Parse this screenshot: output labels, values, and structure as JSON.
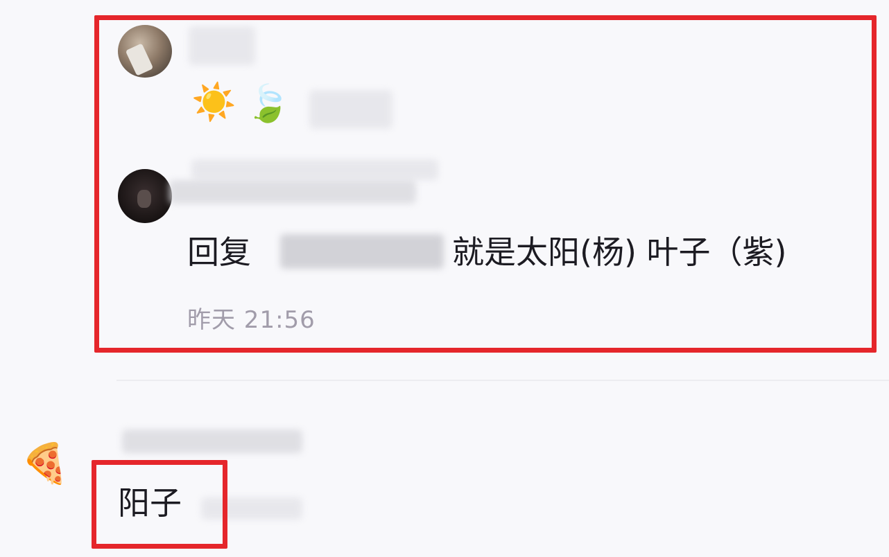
{
  "thread": {
    "first_comment": {
      "avatar": "user-avatar-photo",
      "emoji": [
        "sun-icon",
        "leaf-icon"
      ]
    },
    "reply_comment": {
      "avatar": "user-avatar-dark",
      "reply_prefix": "回复",
      "reply_text": "就是太阳(杨) 叶子（紫)",
      "timestamp": "昨天 21:56"
    },
    "second_comment": {
      "avatar_icon": "pizza-icon",
      "text": "阳子"
    }
  },
  "colors": {
    "highlight": "#e5262b",
    "timestamp": "#a19caa",
    "background": "#f8f8fb"
  }
}
